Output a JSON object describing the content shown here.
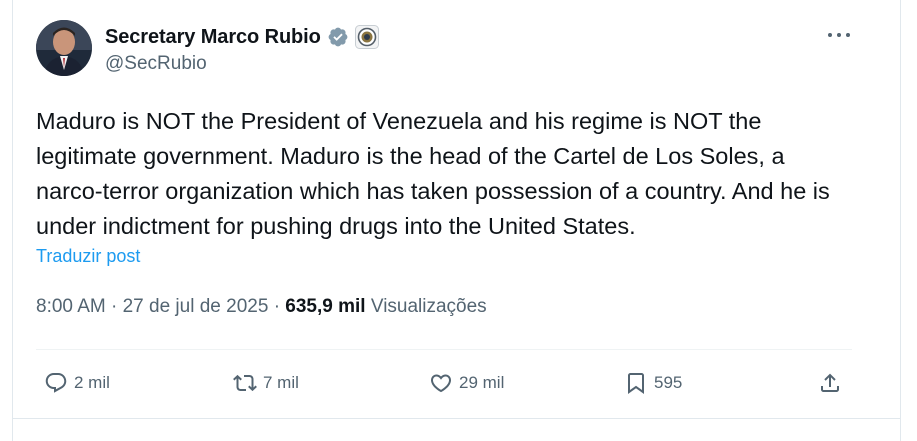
{
  "tweet": {
    "author_name": "Secretary Marco Rubio",
    "author_handle": "@SecRubio",
    "text": "Maduro is NOT the President of Venezuela and his regime is NOT the legitimate government.  Maduro is the head of the Cartel de Los Soles, a narco-terror organization which has taken possession of a country.  And he is under indictment for pushing drugs into the United States.",
    "translate_label": "Traduzir post",
    "time": "8:00 AM",
    "date": "27 de jul de 2025",
    "views_count": "635,9 mil",
    "views_label": "Visualizações",
    "separator": "·"
  },
  "actions": {
    "replies": "2 mil",
    "reposts": "7 mil",
    "likes": "29 mil",
    "bookmarks": "595"
  },
  "icons": {
    "verified": "verified-badge-icon",
    "seal": "government-seal-icon",
    "more": "more-icon",
    "reply": "reply-icon",
    "repost": "repost-icon",
    "like": "heart-icon",
    "bookmark": "bookmark-icon",
    "share": "share-icon"
  },
  "colors": {
    "link": "#1d9bf0",
    "secondary_text": "#536471",
    "primary_text": "#0f1419",
    "verified_badge": "#829aab"
  }
}
